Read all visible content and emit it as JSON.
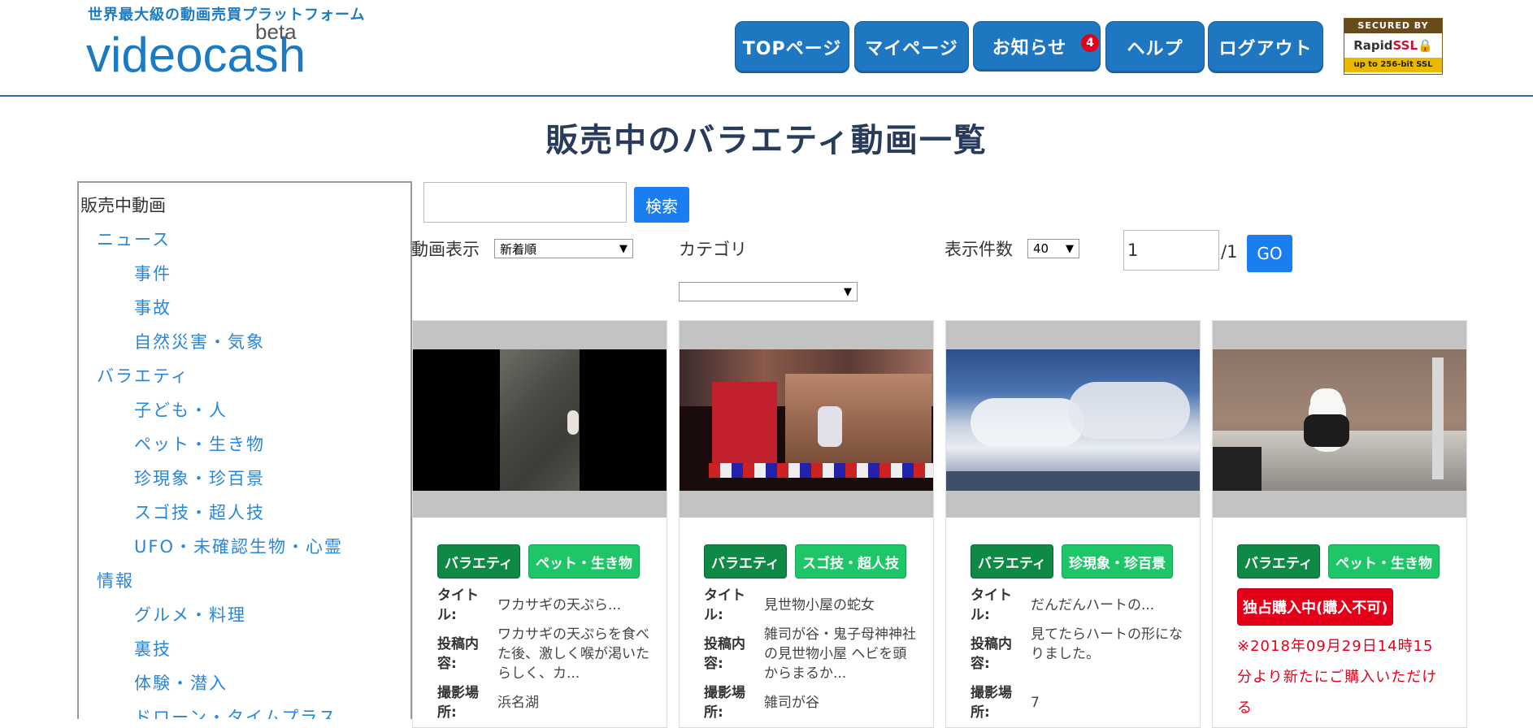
{
  "header": {
    "tagline": "世界最大級の動画売買プラットフォーム",
    "logo_text": "videocash",
    "logo_beta": "beta",
    "nav": [
      {
        "label": "TOPページ"
      },
      {
        "label": "マイページ"
      },
      {
        "label": "お知らせ"
      },
      {
        "label": "ヘルプ"
      },
      {
        "label": "ログアウト"
      }
    ],
    "notification_count": "4",
    "ssl": {
      "top": "SECURED BY",
      "brand_a": "Rapid",
      "brand_b": "SSL",
      "bottom": "up to 256-bit SSL"
    }
  },
  "page_title": "販売中のバラエティ動画一覧",
  "sidebar": {
    "root": "販売中動画",
    "items": [
      {
        "label": "ニュース",
        "level": 1
      },
      {
        "label": "事件",
        "level": 2
      },
      {
        "label": "事故",
        "level": 2
      },
      {
        "label": "自然災害・気象",
        "level": 2
      },
      {
        "label": "バラエティ",
        "level": 1
      },
      {
        "label": "子ども・人",
        "level": 2
      },
      {
        "label": "ペット・生き物",
        "level": 2
      },
      {
        "label": "珍現象・珍百景",
        "level": 2
      },
      {
        "label": "スゴ技・超人技",
        "level": 2
      },
      {
        "label": "UFO・未確認生物・心霊",
        "level": 2
      },
      {
        "label": "情報",
        "level": 1
      },
      {
        "label": "グルメ・料理",
        "level": 2
      },
      {
        "label": "裏技",
        "level": 2
      },
      {
        "label": "体験・潜入",
        "level": 2
      },
      {
        "label": "ドローン・タイムプラス",
        "level": 2
      }
    ]
  },
  "controls": {
    "search_value": "",
    "search_button": "検索",
    "sort_label": "動画表示",
    "sort_value": "新着順",
    "category_label": "カテゴリ",
    "category_value": "",
    "per_page_label": "表示件数",
    "per_page_value": "40",
    "page_value": "1",
    "page_total": "/1",
    "go_button": "GO"
  },
  "labels": {
    "title": "タイトル:",
    "content": "投稿内容:",
    "location": "撮影場所:"
  },
  "cards": [
    {
      "tags": [
        "バラエティ",
        "ペット・生き物"
      ],
      "title": "ワカサギの天ぷら...",
      "content": "ワカサギの天ぷらを食べた後、激しく喉が渇いたらしく、カ...",
      "location": "浜名湖"
    },
    {
      "tags": [
        "バラエティ",
        "スゴ技・超人技"
      ],
      "title": "見世物小屋の蛇女",
      "content": "雑司が谷・鬼子母神神社の見世物小屋 ヘビを頭からまるか...",
      "location": "雑司が谷"
    },
    {
      "tags": [
        "バラエティ",
        "珍現象・珍百景"
      ],
      "title": "だんだんハートの...",
      "content": "見てたらハートの形になりました。",
      "location": "7"
    },
    {
      "tags": [
        "バラエティ",
        "ペット・生き物"
      ],
      "exclusive": "独占購入中(購入不可)",
      "notice": "※2018年09月29日14時15分より新たにご購入いただける"
    }
  ],
  "colors": {
    "accent": "#1f77c2",
    "link": "#2a86d8",
    "tag_dark": "#0f8a46",
    "tag_light": "#1ec667",
    "alert": "#e5001a"
  }
}
